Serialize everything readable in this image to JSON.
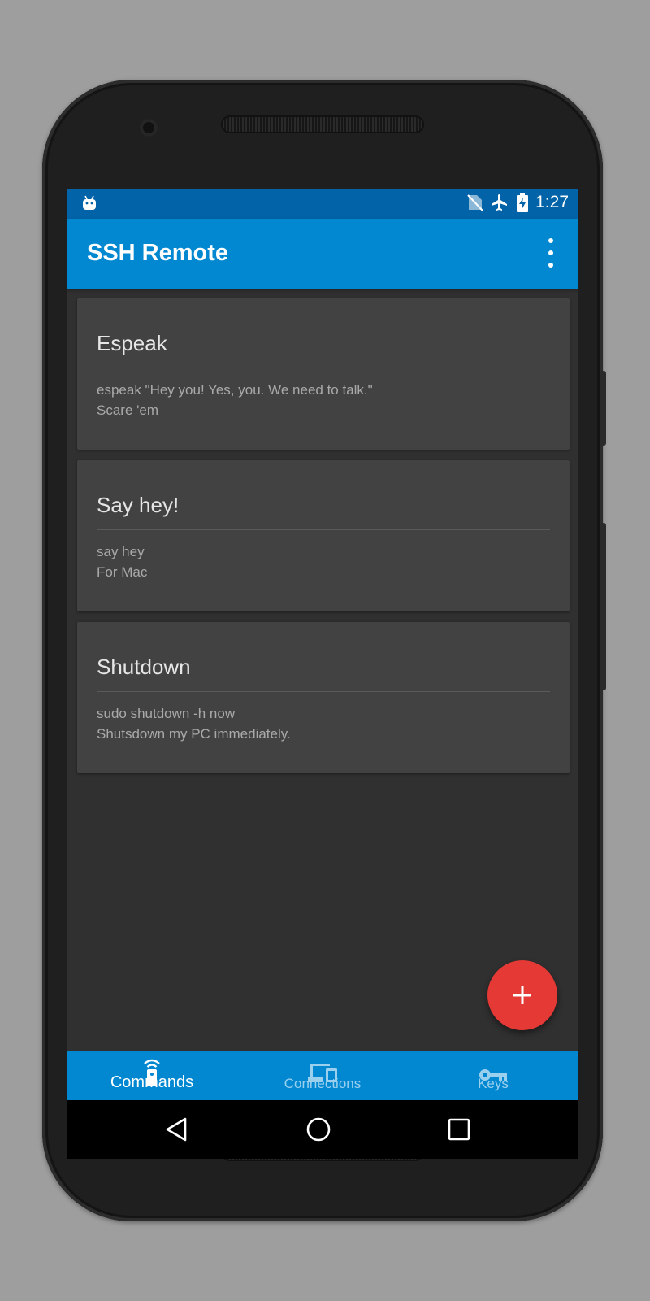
{
  "status_bar": {
    "time": "1:27",
    "icons": [
      "android-debug-icon",
      "no-sim-icon",
      "airplane-mode-icon",
      "battery-charging-icon"
    ]
  },
  "app_bar": {
    "title": "SSH Remote",
    "menu_icon": "more-vert-icon"
  },
  "commands": [
    {
      "title": "Espeak",
      "command": "espeak \"Hey you! Yes, you. We need to talk.\"",
      "description": "Scare 'em"
    },
    {
      "title": "Say hey!",
      "command": "say hey",
      "description": "For Mac"
    },
    {
      "title": "Shutdown",
      "command": "sudo shutdown -h now",
      "description": "Shutsdown my PC immediately."
    }
  ],
  "fab": {
    "icon": "add-icon"
  },
  "bottom_nav": {
    "items": [
      {
        "label": "Commands",
        "icon": "remote-icon",
        "active": true
      },
      {
        "label": "Connections",
        "icon": "devices-icon",
        "active": false
      },
      {
        "label": "Keys",
        "icon": "key-icon",
        "active": false
      }
    ]
  },
  "colors": {
    "primary": "#0288d1",
    "primary_dark": "#0263a8",
    "background": "#303030",
    "card": "#424242",
    "accent": "#e53935",
    "inactive_nav": "#9ad0ee"
  }
}
